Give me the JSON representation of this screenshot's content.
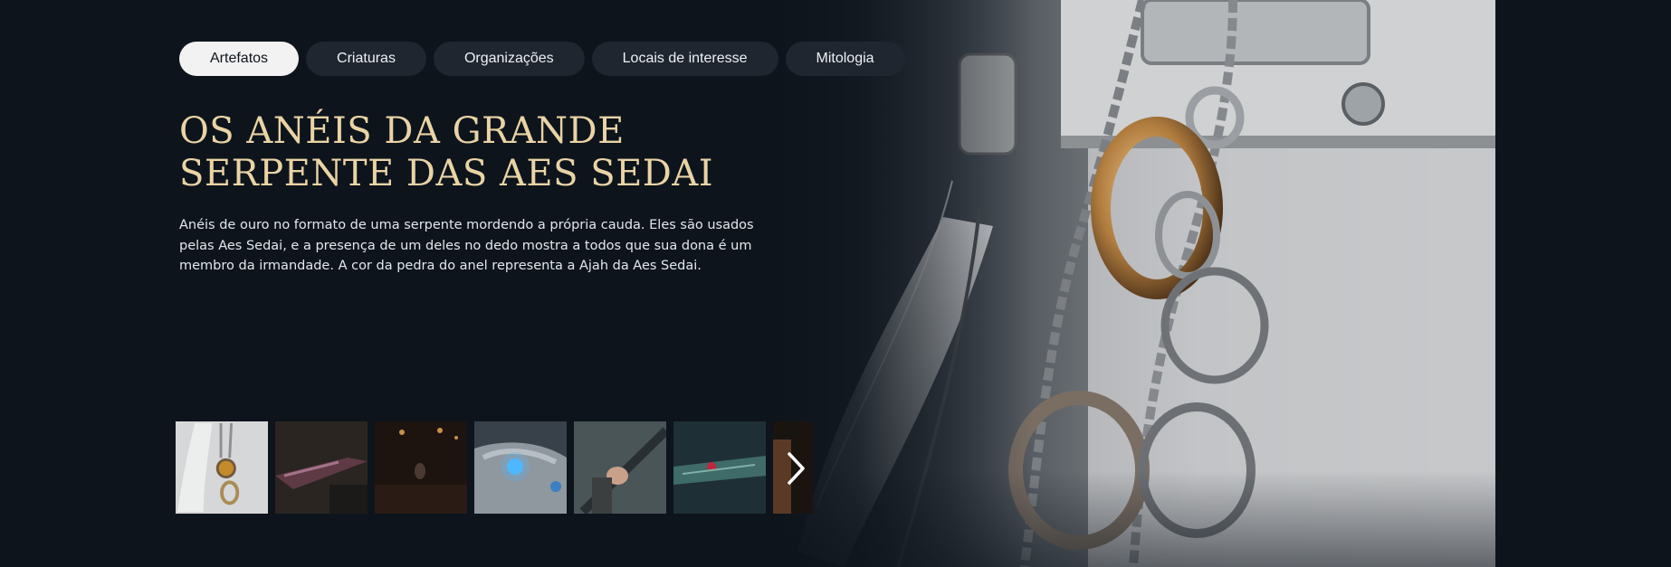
{
  "tabs": [
    {
      "label": "Artefatos",
      "active": true
    },
    {
      "label": "Criaturas",
      "active": false
    },
    {
      "label": "Organizações",
      "active": false
    },
    {
      "label": "Locais de interesse",
      "active": false
    },
    {
      "label": "Mitologia",
      "active": false
    }
  ],
  "article": {
    "title_line1": "OS ANÉIS DA GRANDE",
    "title_line2": "SERPENTE DAS AES SEDAI",
    "description": "Anéis de ouro no formato de uma serpente mordendo a própria cauda. Eles são usados pelas Aes Sedai, e a presença de um deles no dedo mostra a todos que sua dona é um membro da irmandade. A cor da pedra do anel representa a Ajah da Aes Sedai."
  },
  "thumbnails": [
    {
      "name": "thumbnail-rings",
      "selected": true
    },
    {
      "name": "thumbnail-dagger",
      "selected": false
    },
    {
      "name": "thumbnail-dark-hall",
      "selected": false
    },
    {
      "name": "thumbnail-glowing-stone",
      "selected": false
    },
    {
      "name": "thumbnail-staff",
      "selected": false
    },
    {
      "name": "thumbnail-jeweled-dagger",
      "selected": false
    },
    {
      "name": "thumbnail-partial",
      "selected": false
    }
  ],
  "icons": {
    "next": "chevron-right-icon"
  },
  "colors": {
    "background": "#0d141c",
    "title": "#ead3a4",
    "tab_active_bg": "#f2f2f2",
    "tab_bg": "#1f2630"
  }
}
